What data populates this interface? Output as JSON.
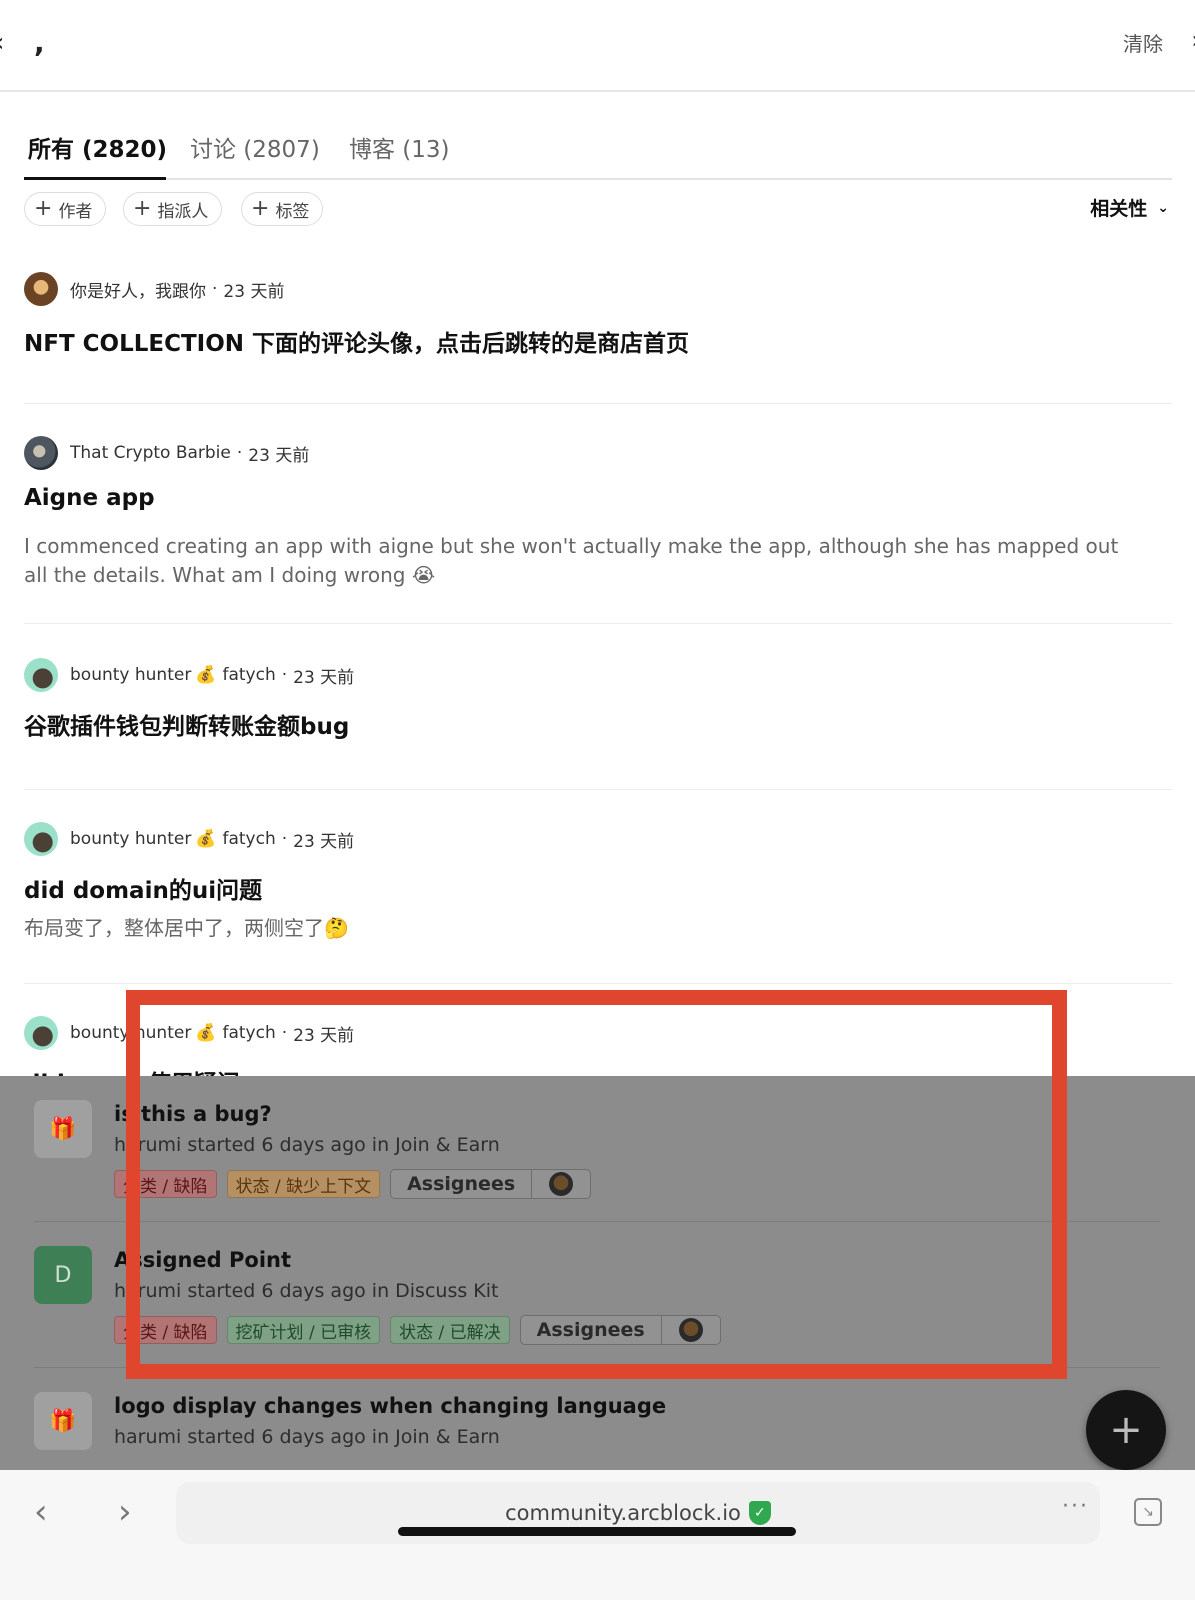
{
  "topbar": {
    "back_glyph": "‹",
    "comma": ",",
    "clear_label": "清除",
    "close_glyph": "›"
  },
  "tabs": [
    {
      "label": "所有 (2820)",
      "active": true
    },
    {
      "label": "讨论 (2807)",
      "active": false
    },
    {
      "label": "博客 (13)",
      "active": false
    }
  ],
  "filters": [
    {
      "label": "作者"
    },
    {
      "label": "指派人"
    },
    {
      "label": "标签"
    }
  ],
  "sort": {
    "label": "相关性"
  },
  "posts": [
    {
      "author": "你是好人，我跟你",
      "time": "23 天前",
      "title": "NFT COLLECTION 下面的评论头像，点击后跳转的是商店首页",
      "excerpt": ""
    },
    {
      "author": "That Crypto Barbie",
      "time": "23 天前",
      "title": "Aigne app",
      "excerpt": "I commenced creating an app with aigne but she won't actually make the app, although she has mapped out all the details. What am I doing wrong 😭"
    },
    {
      "author": "bounty hunter",
      "author_emoji": "💰",
      "author_suffix": "fatych",
      "time": "23 天前",
      "title": "谷歌插件钱包判断转账金额bug",
      "excerpt": ""
    },
    {
      "author": "bounty hunter",
      "author_emoji": "💰",
      "author_suffix": "fatych",
      "time": "23 天前",
      "title": "did domain的ui问题",
      "excerpt": "布局变了，整体居中了，两侧空了🤔"
    },
    {
      "author": "bounty hunter",
      "author_emoji": "💰",
      "author_suffix": "fatych",
      "time": "23 天前",
      "title": "did space使用疑问",
      "excerpt": ""
    }
  ],
  "underlay_items": [
    {
      "icon": "🎁",
      "title": "is this a bug?",
      "sub": "harumi started 6 days ago in Join & Earn",
      "tags": [
        {
          "text": "分类 / 缺陷",
          "color": "red"
        },
        {
          "text": "状态 / 缺少上下文",
          "color": "orange"
        }
      ],
      "assignees_label": "Assignees"
    },
    {
      "icon": "D",
      "title": "Assigned Point",
      "sub": "harumi started 6 days ago in Discuss Kit",
      "tags": [
        {
          "text": "分类 / 缺陷",
          "color": "red"
        },
        {
          "text": "挖矿计划 / 已审核",
          "color": "green"
        },
        {
          "text": "状态 / 已解决",
          "color": "green"
        }
      ],
      "assignees_label": "Assignees"
    },
    {
      "icon": "🎁",
      "title": "logo display changes when changing language",
      "sub": "harumi started 6 days ago in Join & Earn",
      "tags": []
    }
  ],
  "fab": {
    "glyph": "+"
  },
  "browser": {
    "url": "community.arcblock.io",
    "back_glyph": "‹",
    "forward_glyph": "›",
    "more_glyph": "···"
  },
  "colors": {
    "highlight": "#e0462d",
    "verified": "#2fa84f"
  }
}
